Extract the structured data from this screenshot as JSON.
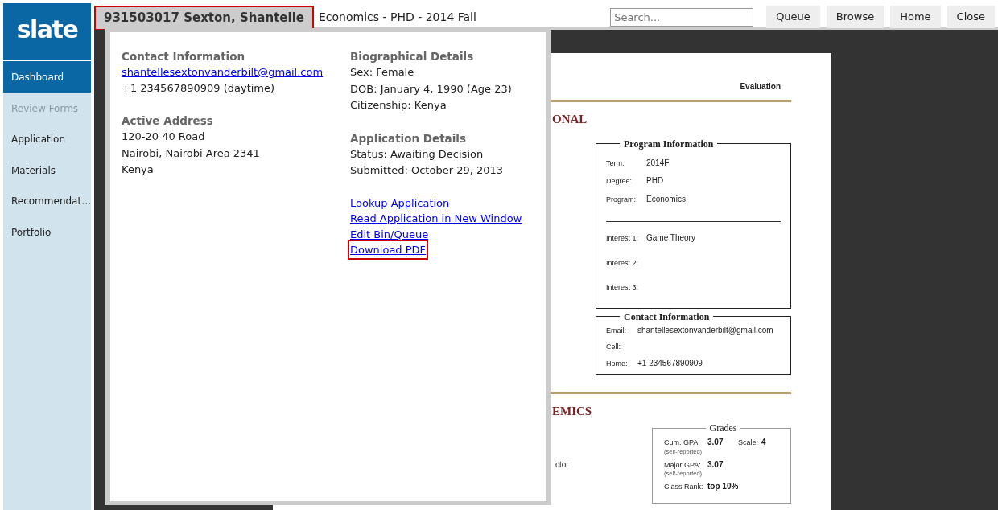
{
  "sidebar": {
    "logo": "slate",
    "items": [
      {
        "label": "Dashboard",
        "selected": true,
        "disabled": false
      },
      {
        "label": "Review Forms",
        "selected": false,
        "disabled": true
      },
      {
        "label": "Application",
        "selected": false,
        "disabled": false
      },
      {
        "label": "Materials",
        "selected": false,
        "disabled": false
      },
      {
        "label": "Recommendat…",
        "selected": false,
        "disabled": false
      },
      {
        "label": "Portfolio",
        "selected": false,
        "disabled": false
      }
    ]
  },
  "header": {
    "applicant": {
      "text": "931503017 Sexton, Shantelle",
      "highlighted": true
    },
    "program": "Economics - PHD - 2014 Fall",
    "search": {
      "placeholder": "Search..."
    },
    "buttons": [
      "Queue",
      "Browse",
      "Home",
      "Close"
    ]
  },
  "popup": {
    "columns": [
      [
        {
          "title": "Contact Information",
          "lines": [
            {
              "kind": "link",
              "text": "shantellesextonvanderbilt@gmail.com"
            },
            {
              "kind": "text",
              "text": "+1 234567890909 (daytime)"
            }
          ]
        },
        {
          "title": "Active Address",
          "lines": [
            {
              "kind": "text",
              "text": "120-20 40 Road"
            },
            {
              "kind": "text",
              "text": "Nairobi, Nairobi Area 2341"
            },
            {
              "kind": "text",
              "text": "Kenya"
            }
          ]
        }
      ],
      [
        {
          "title": "Biographical Details",
          "lines": [
            {
              "kind": "text",
              "text": "Sex: Female"
            },
            {
              "kind": "text",
              "text": "DOB: January 4, 1990 (Age 23)"
            },
            {
              "kind": "text",
              "text": "Citizenship: Kenya"
            }
          ]
        },
        {
          "title": "Application Details",
          "lines": [
            {
              "kind": "text",
              "text": "Status: Awaiting Decision"
            },
            {
              "kind": "text",
              "text": "Submitted: October 29, 2013"
            }
          ]
        }
      ]
    ],
    "links": [
      {
        "label": "Lookup Application",
        "highlighted": false
      },
      {
        "label": "Read Application in New Window",
        "highlighted": false
      },
      {
        "label": "Edit Bin/Queue",
        "highlighted": false
      },
      {
        "label": "Download PDF",
        "highlighted": true
      }
    ]
  },
  "document": {
    "header_right": "Evaluation",
    "section_1_heading": "ONAL",
    "program_box": {
      "title": "Program Information",
      "rows": [
        {
          "label": "Term:",
          "value": "2014F"
        },
        {
          "label": "Degree:",
          "value": "PHD"
        },
        {
          "label": "Program:",
          "value": "Economics"
        }
      ],
      "interests": [
        {
          "label": "Interest 1:",
          "value": "Game Theory"
        },
        {
          "label": "Interest 2:"
        },
        {
          "label": "Interest 3:"
        }
      ]
    },
    "contact_box": {
      "title": "Contact Information",
      "rows": [
        {
          "label": "Email:",
          "value": "shantellesextonvanderbilt@gmail.com"
        },
        {
          "label": "Cell:"
        },
        {
          "label": "Home:",
          "value": "+1 234567890909"
        }
      ]
    },
    "section_2_heading": "EMICS",
    "fragment": "ctor",
    "grades_box": {
      "title": "Grades",
      "rows": [
        {
          "label": "Cum. GPA:",
          "value": "3.07",
          "note": "(self-reported)",
          "extra_label": "Scale:",
          "extra_value": "4"
        },
        {
          "label": "Major GPA:",
          "value": "3.07",
          "note": "(self-reported)"
        },
        {
          "label": "Class Rank:",
          "value": "top 10%"
        }
      ]
    }
  }
}
